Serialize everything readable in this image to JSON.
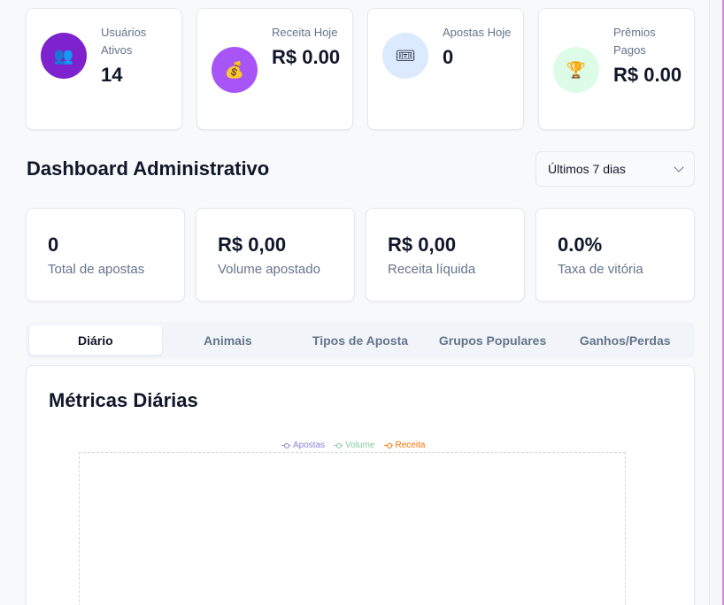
{
  "stats": [
    {
      "label": "Usuários Ativos",
      "value": "14",
      "icon": "users-icon",
      "icon_glyph": "👥",
      "bg": "#7e22ce"
    },
    {
      "label": "Receita Hoje",
      "value": "R$ 0.00",
      "icon": "money-bag-icon",
      "icon_glyph": "💰",
      "bg": "#a855f7"
    },
    {
      "label": "Apostas Hoje",
      "value": "0",
      "icon": "ticket-icon",
      "icon_glyph": "🎟",
      "bg": "#dbeafe"
    },
    {
      "label": "Prêmios Pagos",
      "value": "R$ 0.00",
      "icon": "trophy-icon",
      "icon_glyph": "🏆",
      "bg": "#dcfce7"
    }
  ],
  "dashboard": {
    "title": "Dashboard Administrativo",
    "period": "Últimos 7 dias"
  },
  "metrics": [
    {
      "value": "0",
      "label": "Total de apostas"
    },
    {
      "value": "R$ 0,00",
      "label": "Volume apostado"
    },
    {
      "value": "R$ 0,00",
      "label": "Receita líquida"
    },
    {
      "value": "0.0%",
      "label": "Taxa de vitória"
    }
  ],
  "tabs": [
    {
      "label": "Diário",
      "active": true
    },
    {
      "label": "Animais",
      "active": false
    },
    {
      "label": "Tipos de Aposta",
      "active": false
    },
    {
      "label": "Grupos Populares",
      "active": false
    },
    {
      "label": "Ganhos/Perdas",
      "active": false
    }
  ],
  "chart": {
    "title": "Métricas Diárias",
    "legend": [
      {
        "name": "Apostas",
        "color": "#8884d8"
      },
      {
        "name": "Volume",
        "color": "#82ca9d"
      },
      {
        "name": "Receita",
        "color": "#ff7300"
      }
    ]
  }
}
